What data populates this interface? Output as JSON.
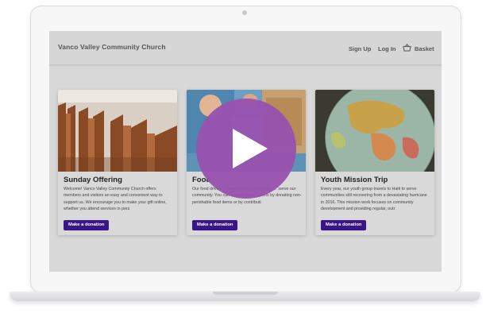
{
  "navbar": {
    "brand": "Vanco Valley Community Church",
    "sign_up": "Sign Up",
    "log_in": "Log In",
    "basket": "Basket"
  },
  "cards": [
    {
      "title": "Sunday Offering",
      "text": "Welcome! Vanco Valley Community Church offers members and visitors an easy and convenient way to support us. We encourage you to make your gift online, whether you attend services in pers",
      "button": "Make a donation"
    },
    {
      "title": "Food",
      "text": "Our food drive … Vanco Valley Community … serve our community. You can support these efforts by donating non-perishable food items or by contributi",
      "button": "Make a donation"
    },
    {
      "title": "Youth Mission Trip",
      "text": "Every year, our youth group travels to Haiti to serve communities still recovering from a devastating hurricane in 2016. This mission work focuses on community development and providing regular, outr",
      "button": "Make a donation"
    }
  ],
  "colors": {
    "accent_button": "#3a1588",
    "play_overlay": "#9752af"
  },
  "icons": {
    "basket": "basket-icon",
    "play": "play-icon"
  }
}
